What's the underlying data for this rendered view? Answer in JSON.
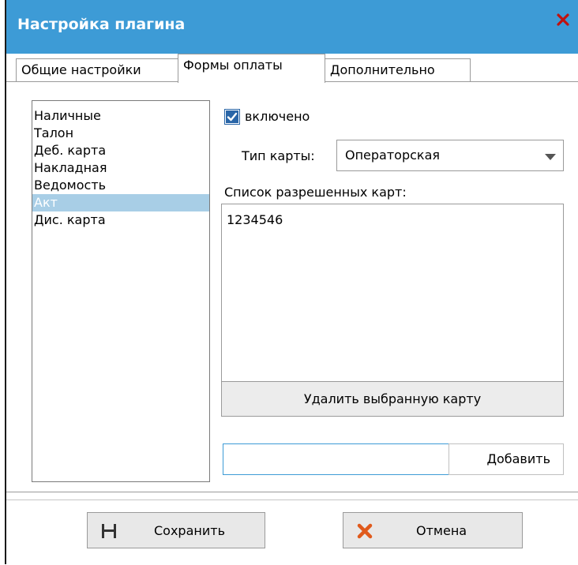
{
  "window": {
    "title": "Настройка плагина",
    "close_glyph": "✕",
    "accent_color": "#3d9bd6",
    "close_color": "#c0110e"
  },
  "tabs": [
    {
      "label": "Общие настройки",
      "active": false
    },
    {
      "label": "Формы оплаты",
      "active": true
    },
    {
      "label": "Дополнительно",
      "active": false
    }
  ],
  "payment_forms": {
    "items": [
      {
        "label": "Наличные",
        "selected": false
      },
      {
        "label": "Талон",
        "selected": false
      },
      {
        "label": "Деб. карта",
        "selected": false
      },
      {
        "label": "Накладная",
        "selected": false
      },
      {
        "label": "Ведомость",
        "selected": false
      },
      {
        "label": "Акт",
        "selected": true
      },
      {
        "label": "Дис. карта",
        "selected": false
      }
    ],
    "selection_color": "#a8cee6"
  },
  "enabled": {
    "label": "включено",
    "checked": true
  },
  "card_type": {
    "label": "Тип карты:",
    "value": "Операторская"
  },
  "allowed_cards": {
    "label": "Список разрешенных карт:",
    "cards": [
      "1234546"
    ],
    "delete_button": "Удалить выбранную карту"
  },
  "add_card": {
    "value": "",
    "button": "Добавить"
  },
  "footer": {
    "save_button": "Сохранить",
    "cancel_button": "Отмена",
    "save_icon": "floppy-icon",
    "cancel_icon": "cross-icon"
  }
}
